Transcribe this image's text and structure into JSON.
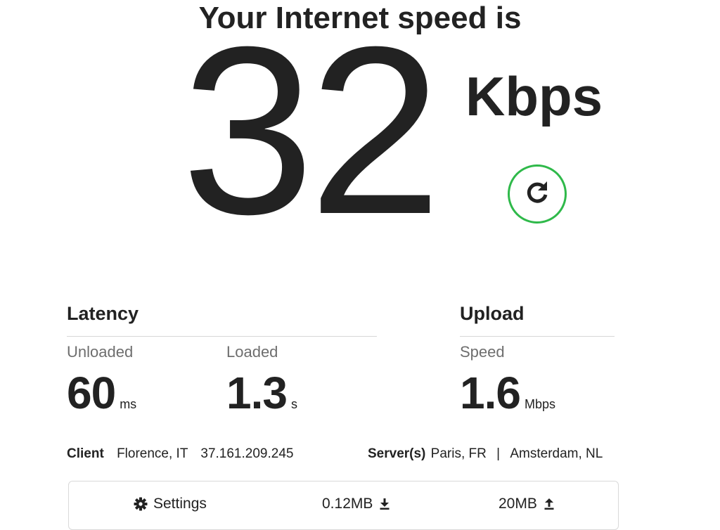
{
  "header": {
    "headline": "Your Internet speed is",
    "speed_value": "32",
    "speed_unit": "Kbps"
  },
  "restart_button": {
    "icon": "restart-icon",
    "accent_color": "#2fb94a"
  },
  "latency": {
    "title": "Latency",
    "unloaded": {
      "label": "Unloaded",
      "value": "60",
      "unit": "ms"
    },
    "loaded": {
      "label": "Loaded",
      "value": "1.3",
      "unit": "s"
    }
  },
  "upload": {
    "title": "Upload",
    "speed": {
      "label": "Speed",
      "value": "1.6",
      "unit": "Mbps"
    }
  },
  "client": {
    "label": "Client",
    "location": "Florence, IT",
    "ip": "37.161.209.245"
  },
  "servers": {
    "label": "Server(s)",
    "primary": "Paris, FR",
    "separator": "|",
    "secondary": "Amsterdam, NL"
  },
  "footer": {
    "settings": {
      "icon": "gear-icon",
      "label": "Settings"
    },
    "download_size": {
      "label": "0.12MB",
      "icon": "download-icon"
    },
    "upload_size": {
      "label": "20MB",
      "icon": "upload-icon"
    }
  }
}
